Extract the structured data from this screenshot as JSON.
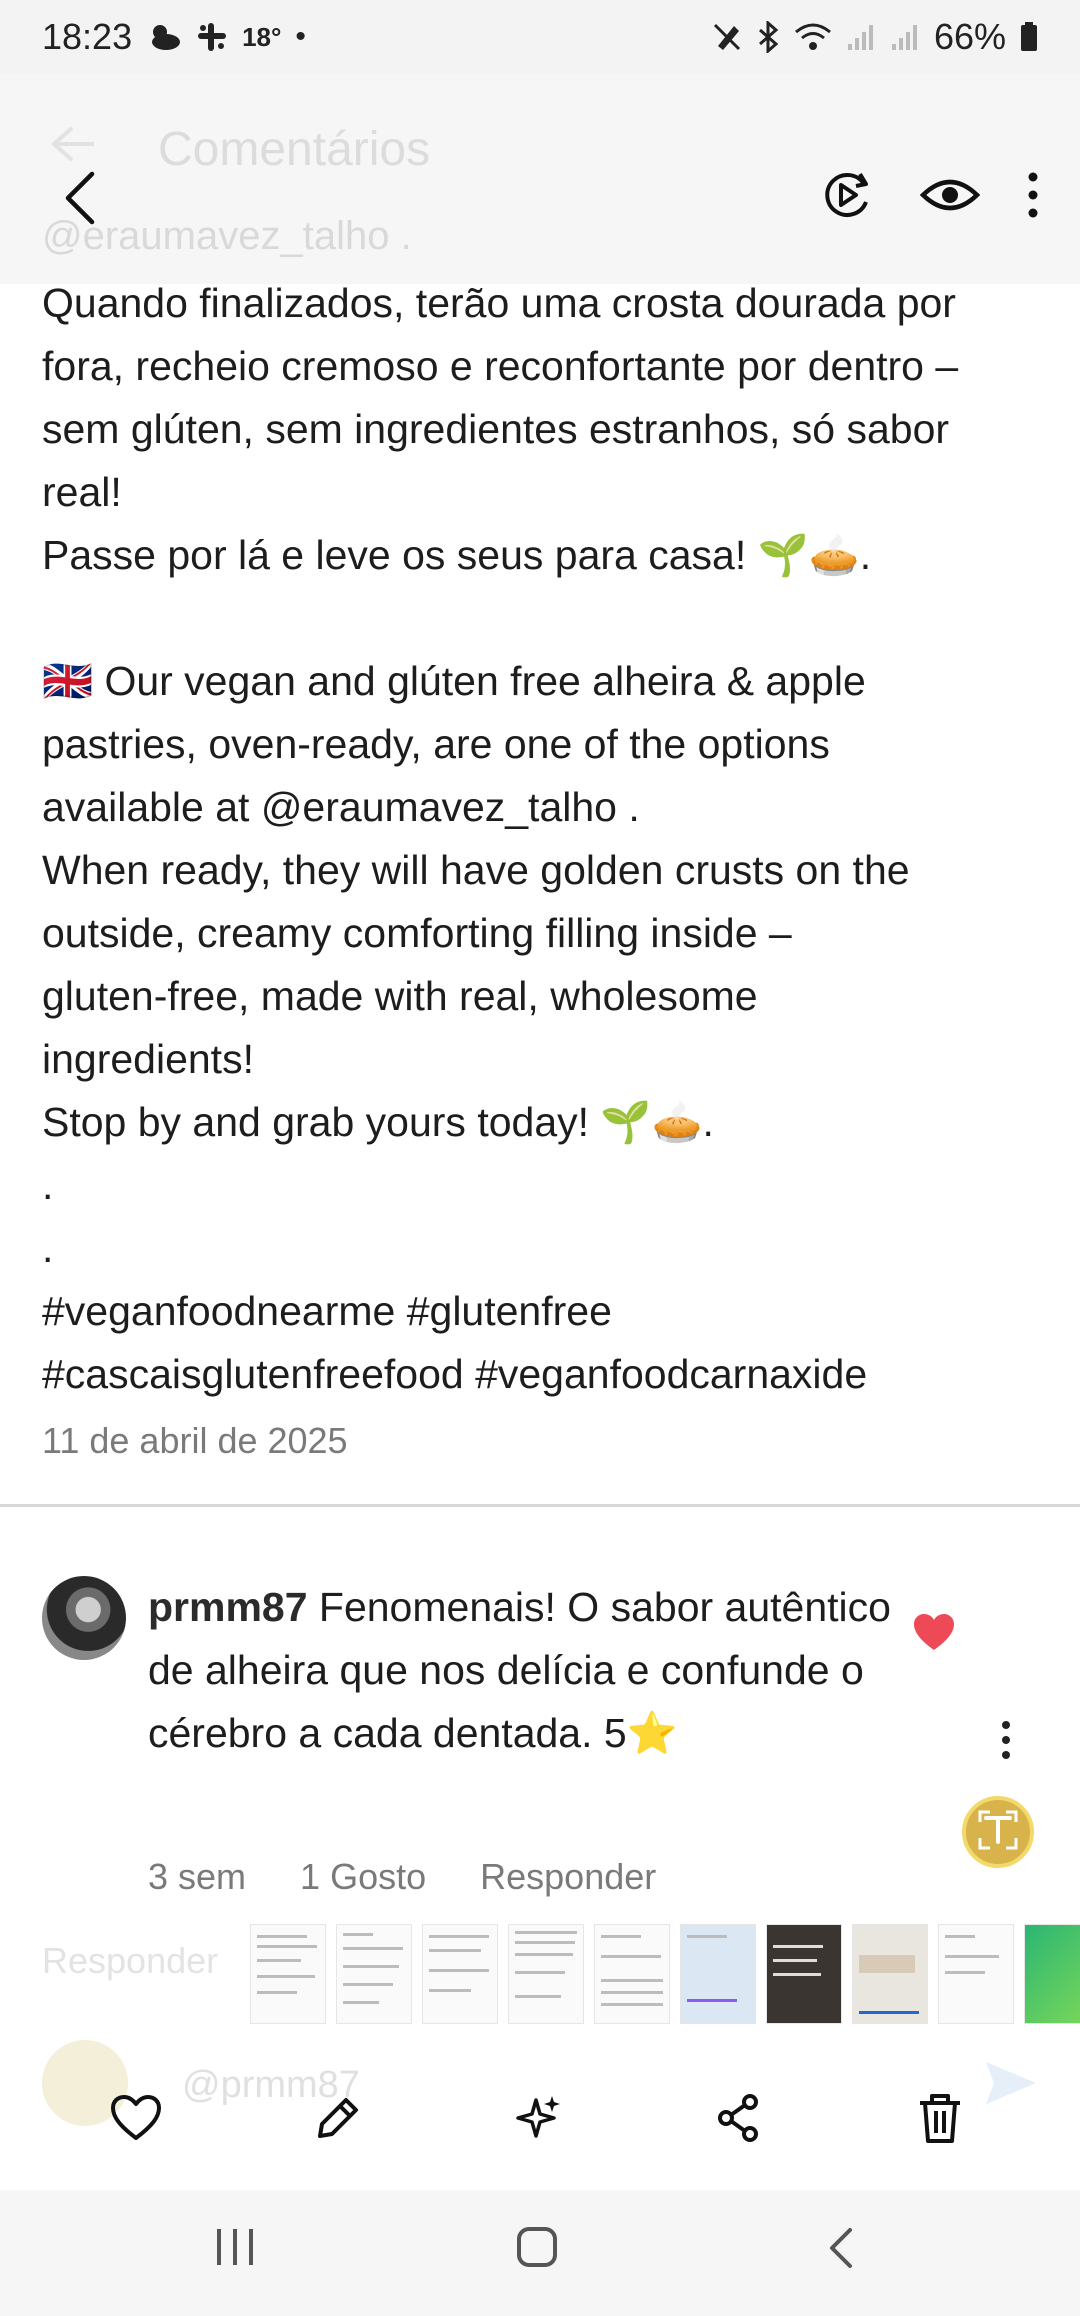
{
  "status_bar": {
    "time": "18:23",
    "temperature": "18°",
    "battery": "66%",
    "icons": [
      "weather-cloudy-icon",
      "slack-icon",
      "dot-icon",
      "no-sim-icon",
      "bluetooth-icon",
      "wifi-icon",
      "signal-icon",
      "signal-icon",
      "battery-icon"
    ]
  },
  "ghost_header": {
    "title": "Comentários",
    "username": "@eraumavez_talho ."
  },
  "viewer_toolbar": {
    "icons": [
      "back-arrow-icon",
      "play-edit-icon",
      "eye-icon",
      "more-vertical-icon"
    ]
  },
  "caption": {
    "lines": [
      "Quando finalizados, terão uma crosta dourada por",
      "fora, recheio cremoso e reconfortante por dentro –",
      "sem glúten, sem ingredientes estranhos, só sabor",
      "real!",
      "Passe por lá e leve os seus para casa! 🌱🥧.",
      "",
      "🇬🇧 Our vegan and glúten free alheira & apple",
      "pastries, oven-ready, are one of the options",
      "available at @eraumavez_talho .",
      "When ready, they will have golden crusts on the",
      "outside, creamy comforting filling inside –",
      "gluten-free, made with real, wholesome",
      "ingredients!",
      "Stop by and grab yours today! 🌱🥧.",
      ".",
      ".",
      "#veganfoodnearme #glutenfree",
      "#cascaisglutenfreefood #veganfoodcarnaxide"
    ],
    "date": "11 de abril de 2025"
  },
  "comment": {
    "username": "prmm87",
    "text": " Fenomenais! O sabor autêntico de alheira que nos  delícia e confunde o cérebro a cada dentada. 5⭐",
    "time": "3 sem",
    "likes": "1 Gosto",
    "reply": "Responder",
    "liked_color": "#ed4956"
  },
  "ghost_footer": {
    "reply_label": "Responder",
    "input_placeholder": "@prmm87"
  },
  "actions": {
    "icons": [
      "heart-icon",
      "edit-pencil-icon",
      "ai-sparkle-icon",
      "share-icon",
      "trash-icon"
    ]
  },
  "nav": {
    "icons": [
      "recent-apps-icon",
      "home-icon",
      "back-icon"
    ]
  }
}
